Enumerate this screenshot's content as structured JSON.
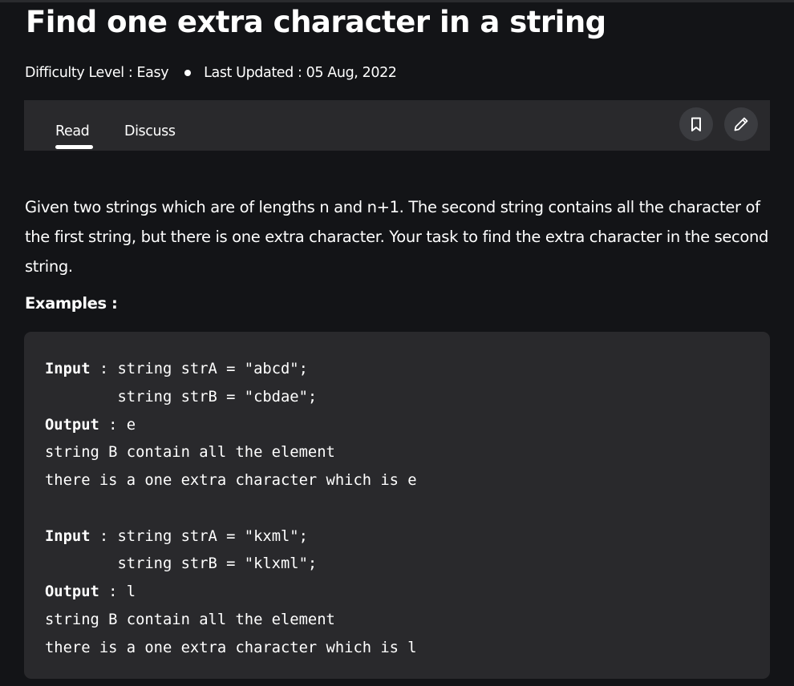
{
  "article": {
    "title": "Find one extra character in a string",
    "difficulty": "Difficulty Level : Easy",
    "updated": "Last Updated : 05 Aug, 2022"
  },
  "tabs": {
    "read": "Read",
    "discuss": "Discuss"
  },
  "actions": {
    "bookmark_icon": "bookmark-icon",
    "edit_icon": "pencil-icon"
  },
  "body": {
    "intro": "Given two strings which are of lengths n and n+1. The second string contains all the character of the first string, but there is one extra character. Your task to find the extra character in the second string.",
    "examples_heading": "Examples :"
  },
  "code": {
    "ex1": {
      "input_label": "Input",
      "input_a": " : string strA = \"abcd\";",
      "input_b": "        string strB = \"cbdae\";",
      "output_label": "Output",
      "output_value": " : e",
      "explain_1": "string B contain all the element",
      "explain_2": "there is a one extra character which is e"
    },
    "ex2": {
      "input_label": "Input",
      "input_a": " : string strA = \"kxml\";",
      "input_b": "        string strB = \"klxml\";",
      "output_label": "Output",
      "output_value": " : l",
      "explain_1": "string B contain all the element",
      "explain_2": "there is a one extra character which is l"
    }
  },
  "colors": {
    "background": "#131417",
    "panel": "#29292c",
    "icon_button": "#3b3c40",
    "text": "#ffffff"
  }
}
